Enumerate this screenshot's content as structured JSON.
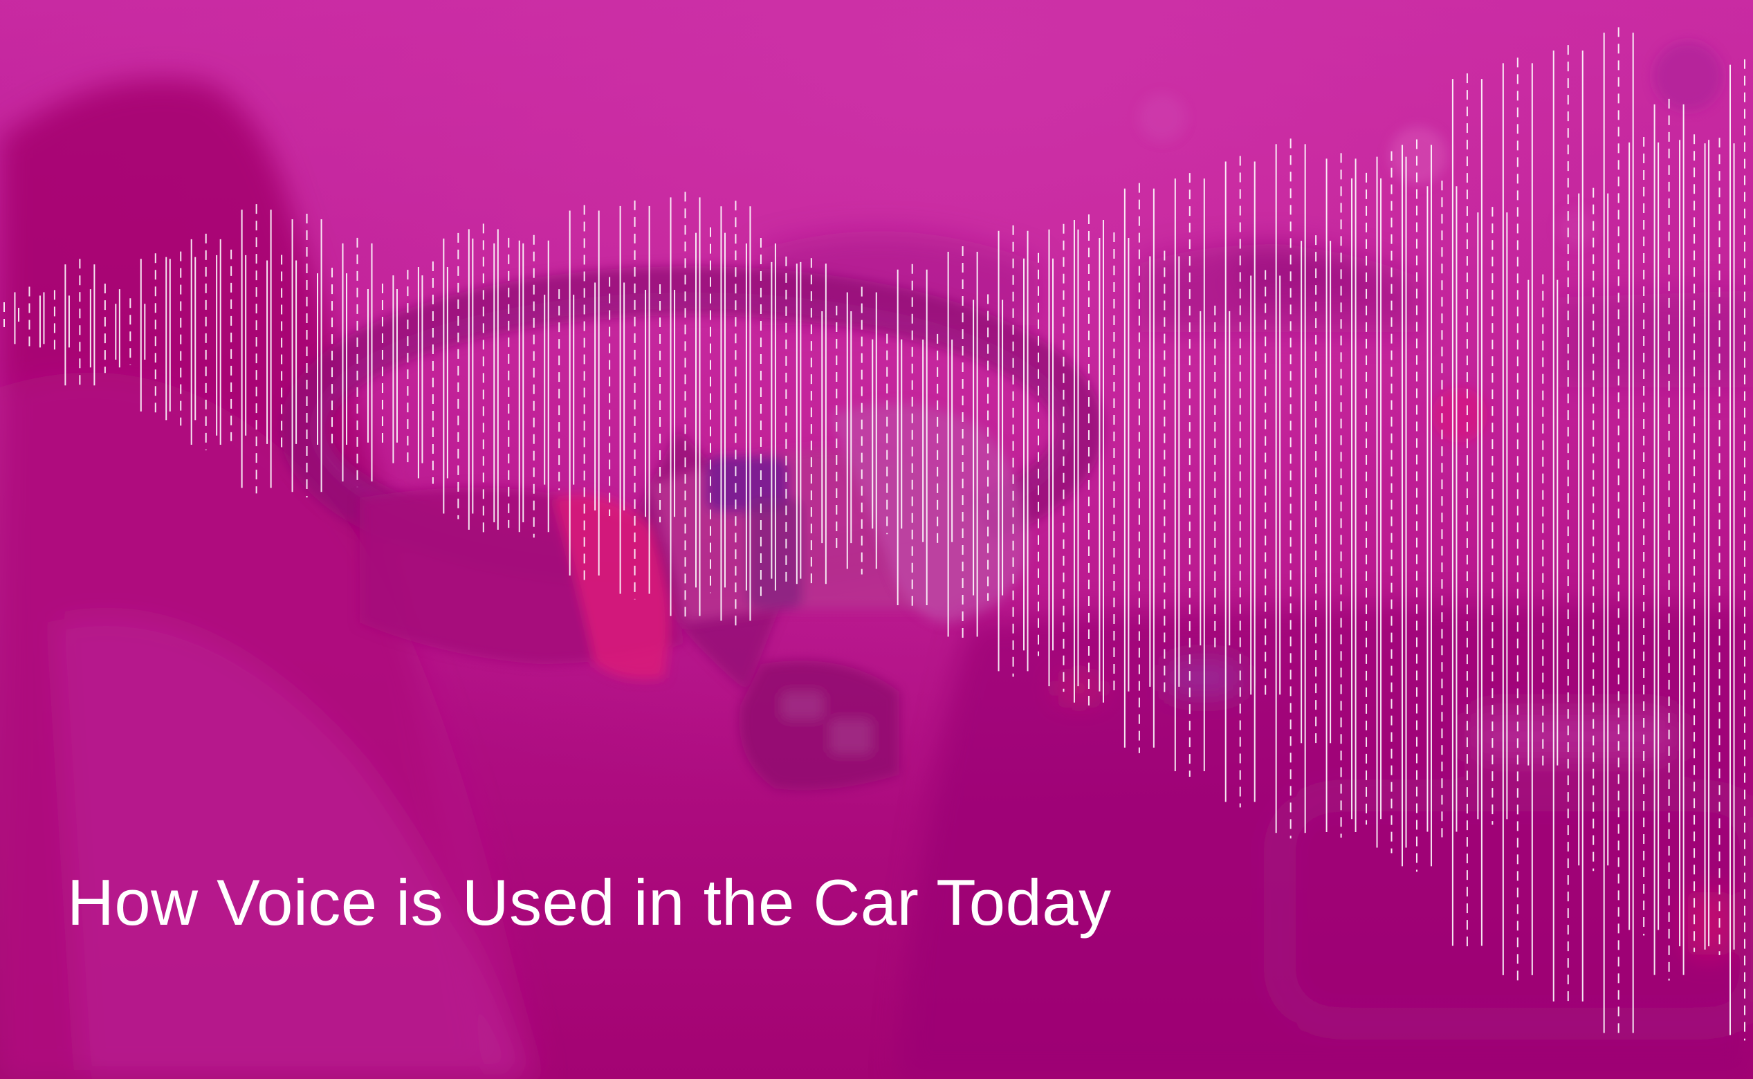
{
  "headline": "How Voice is Used in the Car Today",
  "colors": {
    "overlay": "#c2279f",
    "overlay_dark": "#a4006f",
    "wave_lines": "#ffffff"
  },
  "waveform": {
    "style": "dashed vertical lines",
    "amplitudes": [
      0.04,
      0.06,
      0.09,
      0.13,
      0.11,
      0.07,
      0.18,
      0.2,
      0.22,
      0.25,
      0.28,
      0.3,
      0.27,
      0.29,
      0.24,
      0.22,
      0.2,
      0.26,
      0.31,
      0.33,
      0.35,
      0.3,
      0.28,
      0.36,
      0.4,
      0.38,
      0.35,
      0.42,
      0.46,
      0.44,
      0.4,
      0.37,
      0.34,
      0.31,
      0.28,
      0.3,
      0.33,
      0.35,
      0.38,
      0.42,
      0.45,
      0.48,
      0.5,
      0.53,
      0.55,
      0.57,
      0.6,
      0.58,
      0.56,
      0.62,
      0.65,
      0.68,
      0.66,
      0.7,
      0.74,
      0.78,
      0.76,
      0.82,
      0.86,
      0.9,
      0.88,
      0.84,
      0.92,
      0.96,
      1.0,
      0.97,
      0.93,
      0.89,
      0.95,
      0.99
    ]
  }
}
